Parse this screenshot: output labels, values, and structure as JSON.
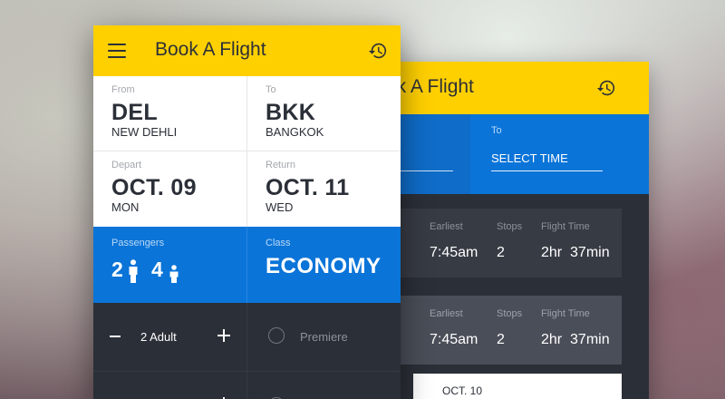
{
  "colors": {
    "header": "#ffd000",
    "accent_blue": "#0a74d8",
    "dark_panel": "#2b2f37",
    "text_dark": "#2c3038"
  },
  "icons": {
    "menu": "hamburger-icon",
    "history": "history-icon",
    "adult": "adult-person-icon",
    "child": "child-person-icon"
  },
  "front": {
    "title": "Book A Flight",
    "from": {
      "label": "From",
      "code": "DEL",
      "city": "NEW DEHLI"
    },
    "to": {
      "label": "To",
      "code": "BKK",
      "city": "BANGKOK"
    },
    "depart": {
      "label": "Depart",
      "date": "OCT. 09",
      "day": "MON"
    },
    "return": {
      "label": "Return",
      "date": "OCT. 11",
      "day": "WED"
    },
    "passengers": {
      "label": "Passengers",
      "adults": "2",
      "children": "4"
    },
    "class": {
      "label": "Class",
      "value": "ECONOMY"
    },
    "adult_stepper": {
      "label": "2 Adult"
    },
    "class_option": {
      "label": "Premiere"
    }
  },
  "back": {
    "title": "ok A Flight",
    "to_label": "To",
    "select_time": "SELECT TIME",
    "results": [
      {
        "earliest_label": "Earliest",
        "earliest": "7:45am",
        "stops_label": "Stops",
        "stops": "2",
        "flight_time_label": "Flight Time",
        "flight_time": "2hr  37min"
      },
      {
        "earliest_label": "Earliest",
        "earliest": "7:45am",
        "stops_label": "Stops",
        "stops": "2",
        "flight_time_label": "Flight Time",
        "flight_time": "2hr  37min"
      }
    ],
    "next_date": "OCT. 10"
  }
}
